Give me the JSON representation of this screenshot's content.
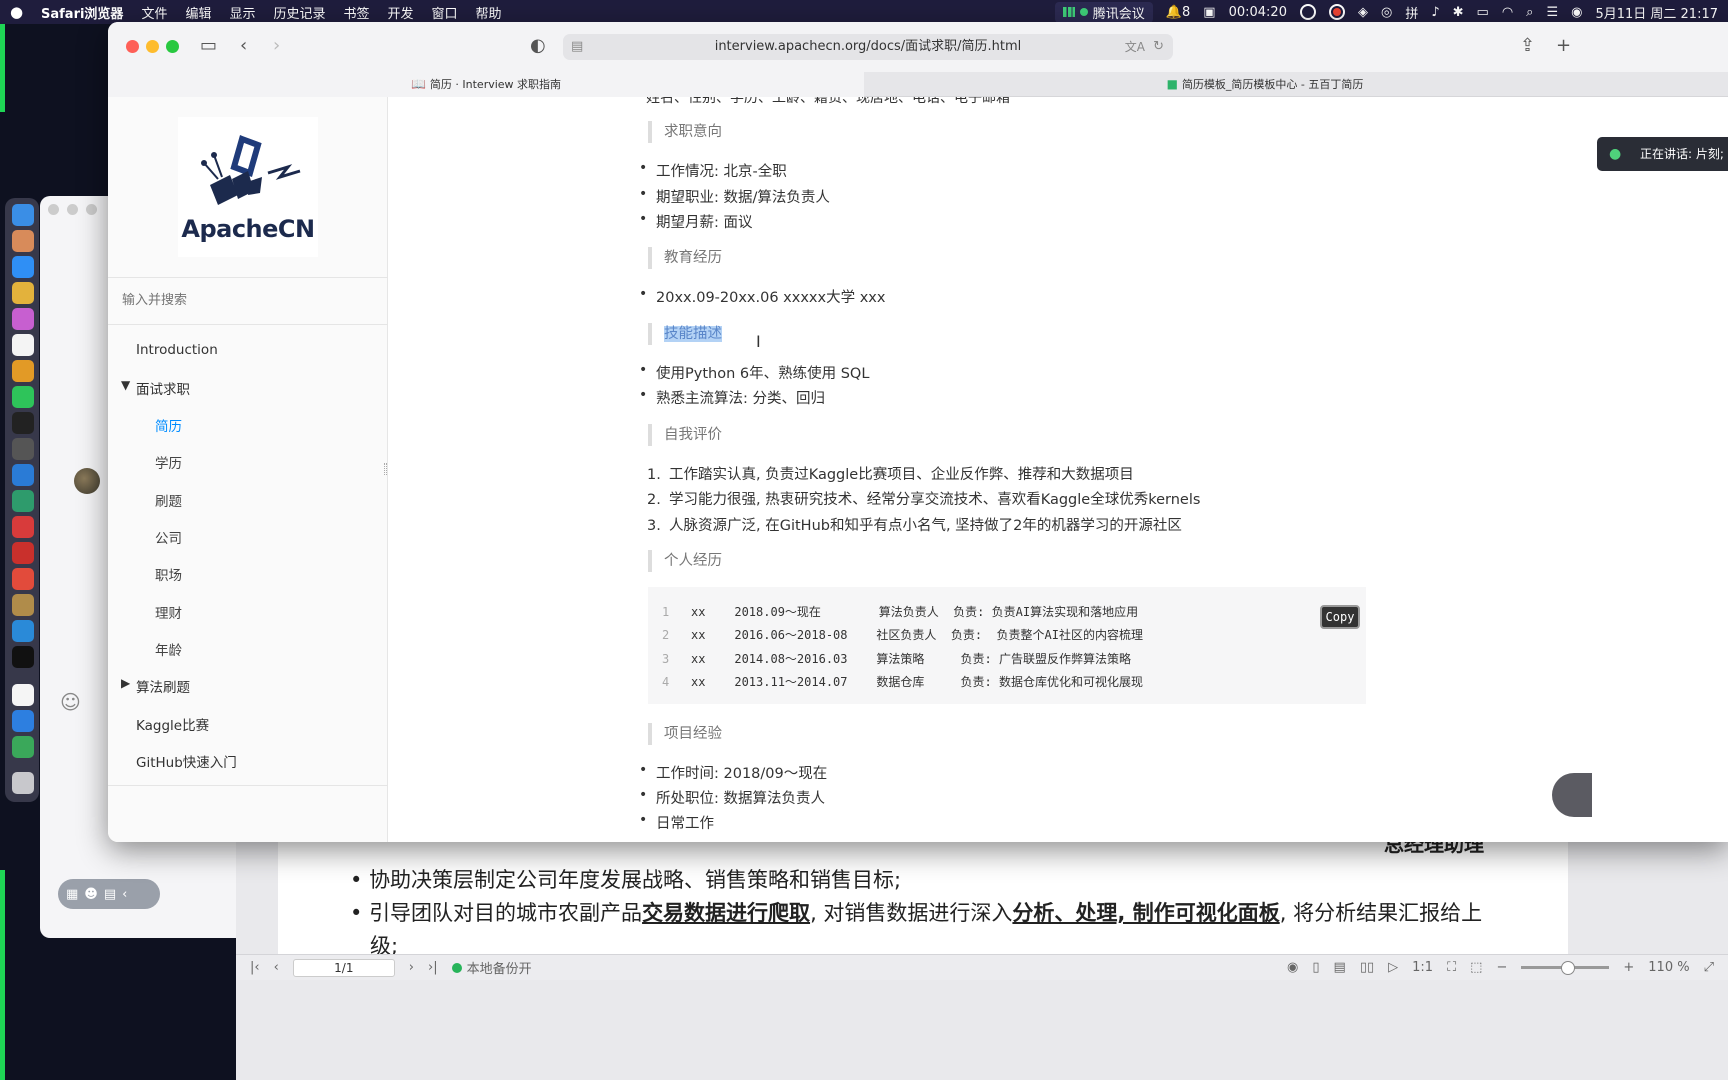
{
  "menubar": {
    "app_name": "Safari浏览器",
    "items": [
      "文件",
      "编辑",
      "显示",
      "历史记录",
      "书签",
      "开发",
      "窗口",
      "帮助"
    ],
    "meeting_label": "腾讯会议",
    "notification_count": "8",
    "timer": "00:04:20",
    "date_time": "5月11日 周二 21:17"
  },
  "safari": {
    "url": "interview.apachecn.org/docs/面试求职/简历.html",
    "tabs": [
      {
        "label": "简历 · Interview 求职指南"
      },
      {
        "label": "简历模板_简历模板中心 - 五百丁简历"
      }
    ]
  },
  "sidebar": {
    "logo_text": "ApacheCN",
    "search_placeholder": "输入并搜索",
    "items": [
      {
        "label": "Introduction"
      },
      {
        "label": "面试求职"
      },
      {
        "label": "简历"
      },
      {
        "label": "学历"
      },
      {
        "label": "刷题"
      },
      {
        "label": "公司"
      },
      {
        "label": "职场"
      },
      {
        "label": "理财"
      },
      {
        "label": "年龄"
      },
      {
        "label": "算法刷题"
      },
      {
        "label": "Kaggle比赛"
      },
      {
        "label": "GitHub快速入门"
      }
    ]
  },
  "content": {
    "cut_line": "姓名、性别、学历、工龄、籍贯、现居地、电话、电子邮箱",
    "sections": [
      {
        "heading": "求职意向",
        "items": [
          "工作情况: 北京-全职",
          "期望职业: 数据/算法负责人",
          "期望月薪: 面议"
        ]
      },
      {
        "heading": "教育经历",
        "items": [
          "20xx.09-20xx.06 xxxxx大学 xxx"
        ]
      },
      {
        "heading": "技能描述",
        "items": [
          "使用Python 6年、熟练使用 SQL",
          "熟悉主流算法: 分类、回归"
        ]
      },
      {
        "heading": "自我评价",
        "items": [
          "工作踏实认真, 负责过Kaggle比赛项目、企业反作弊、推荐和大数据项目",
          "学习能力很强, 热衷研究技术、经常分享交流技术、喜欢看Kaggle全球优秀kernels",
          "人脉资源广泛, 在GitHub和知乎有点小名气, 坚持做了2年的机器学习的开源社区"
        ]
      },
      {
        "heading": "个人经历"
      },
      {
        "heading": "项目经验",
        "items": [
          "工作时间: 2018/09～现在",
          "所处职位: 数据算法负责人",
          "日常工作"
        ]
      }
    ],
    "code_lines": [
      {
        "no": "1",
        "text": "xx    2018.09～现在        算法负责人  负责: 负责AI算法实现和落地应用"
      },
      {
        "no": "2",
        "text": "xx    2016.06～2018-08    社区负责人  负责:  负责整个AI社区的内容梳理"
      },
      {
        "no": "3",
        "text": "xx    2014.08～2016.03    算法策略     负责: 广告联盟反作弊算法策略"
      },
      {
        "no": "4",
        "text": "xx    2013.11～2014.07    数据仓库     负责: 数据仓库优化和可视化展现"
      }
    ],
    "copy_label": "Copy",
    "speaking_label": "正在讲话: 片刻;"
  },
  "pdf": {
    "role_title": "总经理助理",
    "bullet1": "协助决策层制定公司年度发展战略、销售策略和销售目标;",
    "bullet2_a": "引导团队对目的城市农副产品",
    "bullet2_b": "交易数据进行爬取",
    "bullet2_c": ", 对销售数据进行深入",
    "bullet2_d": "分析、处理, 制作可视化面板",
    "bullet2_e": ", 将分析结果汇报给上",
    "bullet2_cont": "级;",
    "page_indicator": "1/1",
    "backup_status": "本地备份开",
    "zoom": "110 %"
  },
  "colors": {
    "accent": "#008cff",
    "menubar": "#1f1d3d",
    "green_edge": "#1fd655",
    "highlight": "#b3d2f5"
  }
}
